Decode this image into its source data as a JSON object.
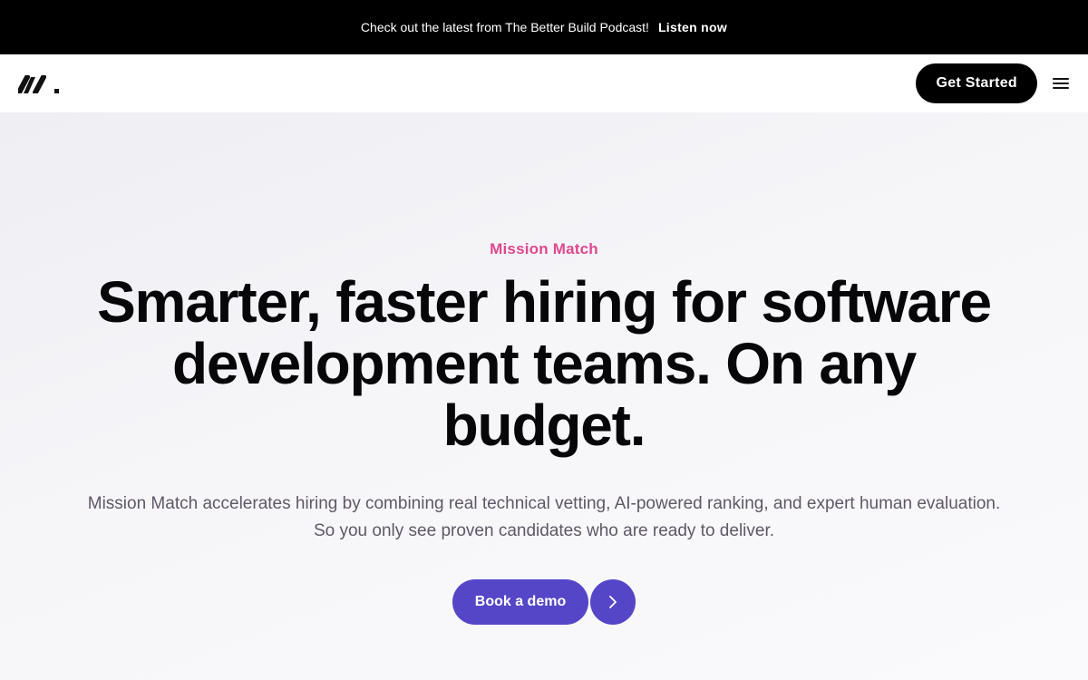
{
  "announcement": {
    "text": "Check out the latest from The Better Build Podcast!",
    "link_label": "Listen now"
  },
  "nav": {
    "logo_icon": "slash-slash-dot-logo",
    "get_started_label": "Get Started",
    "menu_icon": "hamburger-menu-icon"
  },
  "hero": {
    "eyebrow": "Mission Match",
    "headline": "Smarter, faster hiring for software development teams. On any budget.",
    "subtext": "Mission Match accelerates hiring by combining real technical vetting, AI-powered ranking, and expert human evaluation. So you only see proven candidates who are ready to deliver.",
    "demo_label": "Book a demo",
    "arrow_icon": "chevron-right-icon"
  },
  "colors": {
    "eyebrow": "#e0488e",
    "primary_button": "#5546c8",
    "dark": "#000000"
  }
}
